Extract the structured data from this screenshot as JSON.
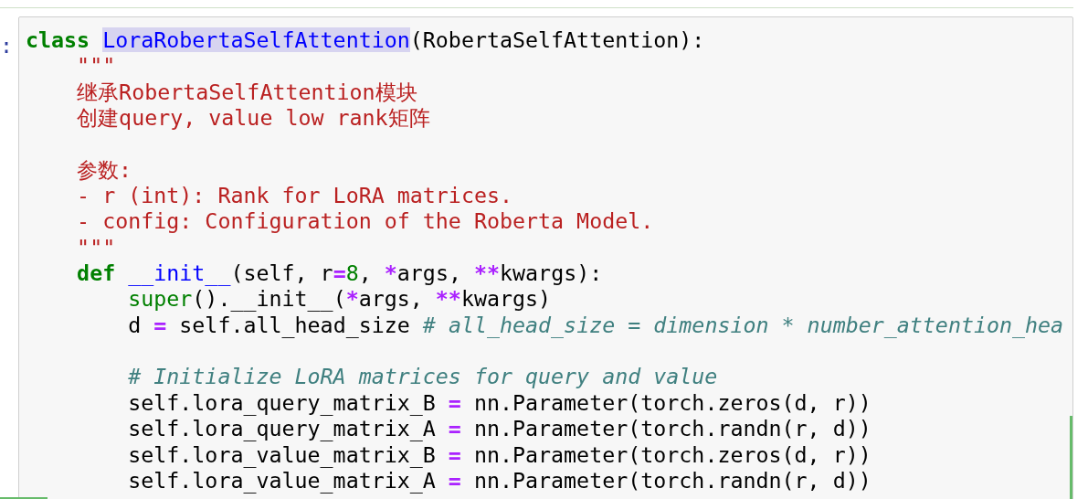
{
  "cell": {
    "prompt": ":",
    "lines": [
      {
        "kind": "code",
        "tokens": [
          {
            "kind": "keyword",
            "text": "class "
          },
          {
            "kind": "name",
            "text": "LoraRobertaSelfAttention",
            "highlighted": true
          },
          {
            "kind": "plain",
            "text": "(RobertaSelfAttention):"
          }
        ]
      },
      {
        "kind": "code",
        "tokens": [
          {
            "kind": "string",
            "text": "    \"\"\""
          }
        ]
      },
      {
        "kind": "code",
        "tokens": [
          {
            "kind": "string",
            "text": "    继承RobertaSelfAttention模块"
          }
        ]
      },
      {
        "kind": "code",
        "tokens": [
          {
            "kind": "string",
            "text": "    创建query, value low rank矩阵"
          }
        ]
      },
      {
        "kind": "blank"
      },
      {
        "kind": "code",
        "tokens": [
          {
            "kind": "string",
            "text": "    参数:"
          }
        ]
      },
      {
        "kind": "code",
        "tokens": [
          {
            "kind": "string",
            "text": "    - r (int): Rank for LoRA matrices."
          }
        ]
      },
      {
        "kind": "code",
        "tokens": [
          {
            "kind": "string",
            "text": "    - config: Configuration of the Roberta Model."
          }
        ]
      },
      {
        "kind": "code",
        "tokens": [
          {
            "kind": "string",
            "text": "    \"\"\""
          }
        ]
      },
      {
        "kind": "code",
        "tokens": [
          {
            "kind": "keyword",
            "text": "    def "
          },
          {
            "kind": "name",
            "text": "__init__",
            "highlighted": false
          },
          {
            "kind": "plain",
            "text": "(self, r"
          },
          {
            "kind": "operator",
            "text": "="
          },
          {
            "kind": "number",
            "text": "8"
          },
          {
            "kind": "plain",
            "text": ", "
          },
          {
            "kind": "operator",
            "text": "*"
          },
          {
            "kind": "plain",
            "text": "args, "
          },
          {
            "kind": "operator",
            "text": "**"
          },
          {
            "kind": "plain",
            "text": "kwargs):"
          }
        ]
      },
      {
        "kind": "code",
        "tokens": [
          {
            "kind": "builtin",
            "text": "        super"
          },
          {
            "kind": "plain",
            "text": "().__init__("
          },
          {
            "kind": "operator",
            "text": "*"
          },
          {
            "kind": "plain",
            "text": "args, "
          },
          {
            "kind": "operator",
            "text": "**"
          },
          {
            "kind": "plain",
            "text": "kwargs)"
          }
        ]
      },
      {
        "kind": "code",
        "tokens": [
          {
            "kind": "plain",
            "text": "        d "
          },
          {
            "kind": "operator",
            "text": "="
          },
          {
            "kind": "plain",
            "text": " self.all_head_size "
          },
          {
            "kind": "comment",
            "text": "# all_head_size = dimension * number_attention_hea"
          }
        ]
      },
      {
        "kind": "blank"
      },
      {
        "kind": "code",
        "tokens": [
          {
            "kind": "comment",
            "text": "        # Initialize LoRA matrices for query and value"
          }
        ]
      },
      {
        "kind": "code",
        "tokens": [
          {
            "kind": "plain",
            "text": "        self.lora_query_matrix_B "
          },
          {
            "kind": "operator",
            "text": "="
          },
          {
            "kind": "plain",
            "text": " nn.Parameter(torch.zeros(d, r))"
          }
        ]
      },
      {
        "kind": "code",
        "tokens": [
          {
            "kind": "plain",
            "text": "        self.lora_query_matrix_A "
          },
          {
            "kind": "operator",
            "text": "="
          },
          {
            "kind": "plain",
            "text": " nn.Parameter(torch.randn(r, d))"
          }
        ]
      },
      {
        "kind": "code",
        "tokens": [
          {
            "kind": "plain",
            "text": "        self.lora_value_matrix_B "
          },
          {
            "kind": "operator",
            "text": "="
          },
          {
            "kind": "plain",
            "text": " nn.Parameter(torch.zeros(d, r))"
          }
        ]
      },
      {
        "kind": "code",
        "tokens": [
          {
            "kind": "plain",
            "text": "        self.lora_value_matrix_A "
          },
          {
            "kind": "operator",
            "text": "="
          },
          {
            "kind": "plain",
            "text": " nn.Parameter(torch.randn(r, d))"
          }
        ]
      }
    ]
  }
}
